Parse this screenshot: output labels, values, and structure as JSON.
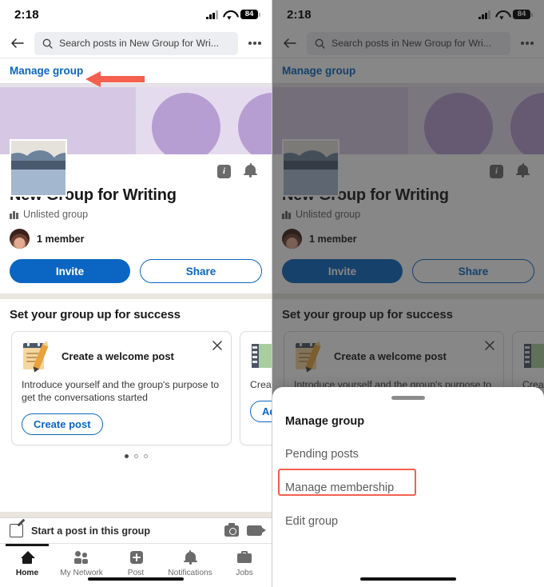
{
  "status_bar": {
    "time": "2:18",
    "battery": "84",
    "wifi_icon": "wifi-icon",
    "signal_icon": "cellular-signal-icon"
  },
  "top_bar": {
    "back_icon": "back-arrow-icon",
    "search_icon": "search-icon",
    "search_placeholder": "Search posts in New Group for Wri...",
    "overflow_icon": "more-options-icon"
  },
  "manage_bar": {
    "link_label": "Manage group"
  },
  "group": {
    "name": "New Group for Writing",
    "type_label": "Unlisted group",
    "type_icon": "group-people-icon",
    "member_count_label": "1 member",
    "info_icon": "info-icon",
    "bell_icon": "notification-bell-icon",
    "avatar_name": "group-avatar",
    "buttons": {
      "invite": "Invite",
      "share": "Share"
    }
  },
  "success_section": {
    "title": "Set your group up for success",
    "cards": [
      {
        "emoji_icon": "notepad-pencil-icon",
        "title": "Create a welcome post",
        "body": "Introduce yourself and the group's purpose to get the conversations started",
        "cta": "Create post",
        "close_icon": "close-icon"
      },
      {
        "emoji_icon": "building-chart-icon",
        "title": "",
        "body": "Create\nposts",
        "cta": "Add",
        "close_icon": "close-icon"
      }
    ],
    "pager": {
      "total": 3,
      "active_index": 0
    }
  },
  "compose_row": {
    "label": "Start a post in this group",
    "pen_icon": "compose-pen-icon",
    "camera_icon": "camera-icon",
    "video_icon": "video-camera-icon"
  },
  "bottom_nav": {
    "items": [
      {
        "label": "Home",
        "icon": "home-icon",
        "active": true
      },
      {
        "label": "My Network",
        "icon": "my-network-icon",
        "active": false
      },
      {
        "label": "Post",
        "icon": "post-plus-icon",
        "active": false
      },
      {
        "label": "Notifications",
        "icon": "bell-icon",
        "active": false
      },
      {
        "label": "Jobs",
        "icon": "briefcase-icon",
        "active": false
      }
    ]
  },
  "bottom_sheet": {
    "grabber": "sheet-grabber",
    "title": "Manage group",
    "items": [
      {
        "label": "Pending posts",
        "highlighted": false
      },
      {
        "label": "Manage membership",
        "highlighted": true
      },
      {
        "label": "Edit group",
        "highlighted": false
      }
    ]
  },
  "annotations": {
    "arrow_color": "#f4604d",
    "highlight_color": "#f4604d",
    "arrow_target": "Manage group"
  },
  "colors": {
    "accent_blue": "#0a66c2",
    "cover_purple": "#d6c8e4",
    "cover_purple_light": "#e4dcee",
    "circle_purple": "#b79ed2",
    "dim_overlay": "rgba(34,34,34,0.54)"
  }
}
